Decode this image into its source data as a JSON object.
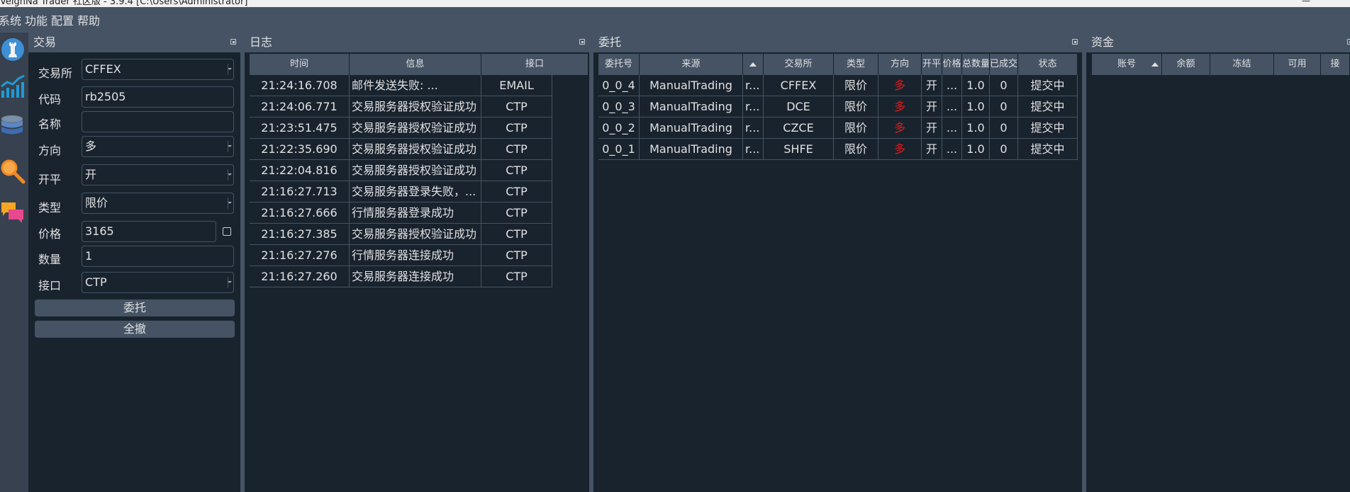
{
  "window": {
    "title": "VeighNa Trader 社区版 - 3.9.4   [C:\\Users\\Administrator]"
  },
  "menu": [
    "系统",
    "功能",
    "配置",
    "帮助"
  ],
  "toolbar": [
    {
      "name": "trading-chess-icon"
    },
    {
      "name": "chart-icon"
    },
    {
      "name": "database-icon"
    },
    {
      "name": "search-icon"
    },
    {
      "name": "chat-icon"
    }
  ],
  "trade_panel": {
    "title": "交易",
    "fields": [
      {
        "label": "交易所",
        "value": "CFFEX",
        "type": "combo"
      },
      {
        "label": "代码",
        "value": "rb2505",
        "type": "input"
      },
      {
        "label": "名称",
        "value": "",
        "type": "input"
      },
      {
        "label": "方向",
        "value": "多",
        "type": "combo"
      },
      {
        "label": "开平",
        "value": "开",
        "type": "combo"
      },
      {
        "label": "类型",
        "value": "限价",
        "type": "combo"
      },
      {
        "label": "价格",
        "value": "3165",
        "type": "input"
      },
      {
        "label": "数量",
        "value": "1",
        "type": "input"
      },
      {
        "label": "接口",
        "value": "CTP",
        "type": "combo"
      }
    ],
    "send_button": "委托",
    "cancel_all_button": "全撤"
  },
  "log_panel": {
    "title": "日志",
    "columns": [
      "时间",
      "信息",
      "接口"
    ],
    "rows": [
      [
        "21:24:16.708",
        "邮件发送失败: ...",
        "EMAIL"
      ],
      [
        "21:24:06.771",
        "交易服务器授权验证成功",
        "CTP"
      ],
      [
        "21:23:51.475",
        "交易服务器授权验证成功",
        "CTP"
      ],
      [
        "21:22:35.690",
        "交易服务器授权验证成功",
        "CTP"
      ],
      [
        "21:22:04.816",
        "交易服务器授权验证成功",
        "CTP"
      ],
      [
        "21:16:27.713",
        "交易服务器登录失败，...",
        "CTP"
      ],
      [
        "21:16:27.666",
        "行情服务器登录成功",
        "CTP"
      ],
      [
        "21:16:27.385",
        "交易服务器授权验证成功",
        "CTP"
      ],
      [
        "21:16:27.276",
        "行情服务器连接成功",
        "CTP"
      ],
      [
        "21:16:27.260",
        "交易服务器连接成功",
        "CTP"
      ]
    ]
  },
  "order_panel": {
    "title": "委托",
    "columns": [
      "委托号",
      "来源",
      "",
      "交易所",
      "类型",
      "方向",
      "开平",
      "价格",
      "总数量",
      "已成交",
      "状态"
    ],
    "rows": [
      [
        "0_0_4",
        "ManualTrading",
        "r...",
        "CFFEX",
        "限价",
        "多",
        "开",
        "...",
        "1.0",
        "0",
        "提交中"
      ],
      [
        "0_0_3",
        "ManualTrading",
        "r...",
        "DCE",
        "限价",
        "多",
        "开",
        "...",
        "1.0",
        "0",
        "提交中"
      ],
      [
        "0_0_2",
        "ManualTrading",
        "r...",
        "CZCE",
        "限价",
        "多",
        "开",
        "...",
        "1.0",
        "0",
        "提交中"
      ],
      [
        "0_0_1",
        "ManualTrading",
        "r...",
        "SHFE",
        "限价",
        "多",
        "开",
        "...",
        "1.0",
        "0",
        "提交中"
      ]
    ]
  },
  "account_panel": {
    "title": "资金",
    "columns": [
      "账号",
      "余额",
      "冻结",
      "可用",
      "接"
    ]
  },
  "colors": {
    "background": "#19232d",
    "header": "#455364",
    "long": "#e01a1a"
  }
}
